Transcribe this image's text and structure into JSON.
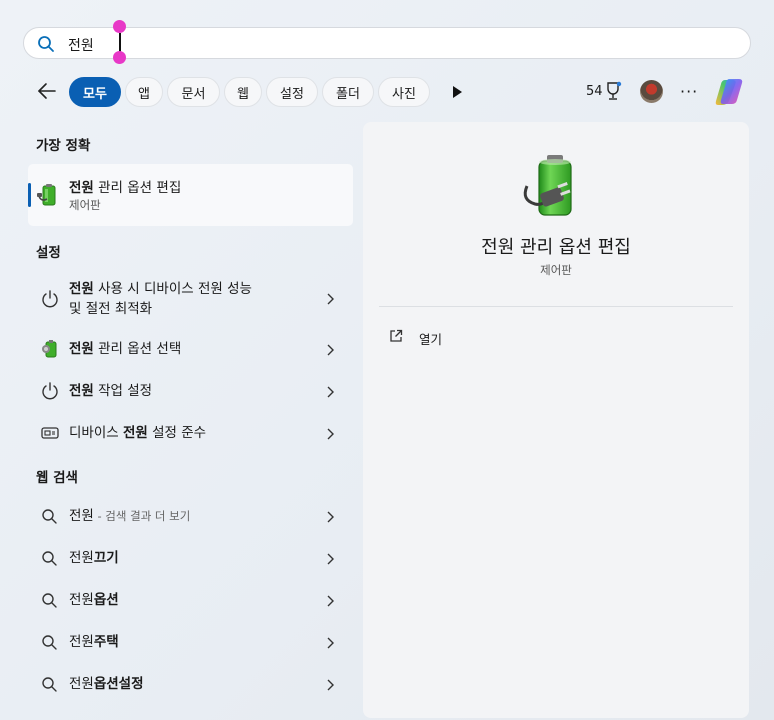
{
  "search": {
    "query": "전원"
  },
  "filters": [
    {
      "label": "모두",
      "active": true
    },
    {
      "label": "앱"
    },
    {
      "label": "문서"
    },
    {
      "label": "웹"
    },
    {
      "label": "설정"
    },
    {
      "label": "폴더"
    },
    {
      "label": "사진"
    }
  ],
  "header": {
    "points": "54",
    "more_label": "···"
  },
  "sections": {
    "best_match": "가장 정확",
    "settings": "설정",
    "web_search": "웹 검색"
  },
  "best_match": {
    "title_bold": "전원",
    "title_rest": " 관리 옵션 편집",
    "subtitle": "제어판"
  },
  "settings_items": [
    {
      "bold": "전원",
      "rest": " 사용 시 디바이스 전원 성능",
      "line2": "및 절전 최적화",
      "icon": "power-icon"
    },
    {
      "bold": "전원",
      "rest": " 관리 옵션 선택",
      "icon": "battery-plug-icon"
    },
    {
      "bold": "전원",
      "rest": " 작업 설정",
      "icon": "power-icon"
    },
    {
      "pre": "디바이스 ",
      "bold": "전원",
      "rest": " 설정 준수",
      "icon": "device-power-icon"
    }
  ],
  "web_items": [
    {
      "normal": "전원",
      "suffix": " - 검색 결과 더 보기"
    },
    {
      "normal": "전원",
      "bold": "끄기"
    },
    {
      "normal": "전원",
      "bold": "옵션"
    },
    {
      "normal": "전원",
      "bold": "주택"
    },
    {
      "normal": "전원",
      "bold": "옵션설정"
    }
  ],
  "preview": {
    "title": "전원 관리 옵션 편집",
    "subtitle": "제어판",
    "action_open": "열기"
  },
  "colors": {
    "accent": "#0a5fb3",
    "battery_green": "#3fae2a",
    "selection_handle": "#e838c7"
  }
}
